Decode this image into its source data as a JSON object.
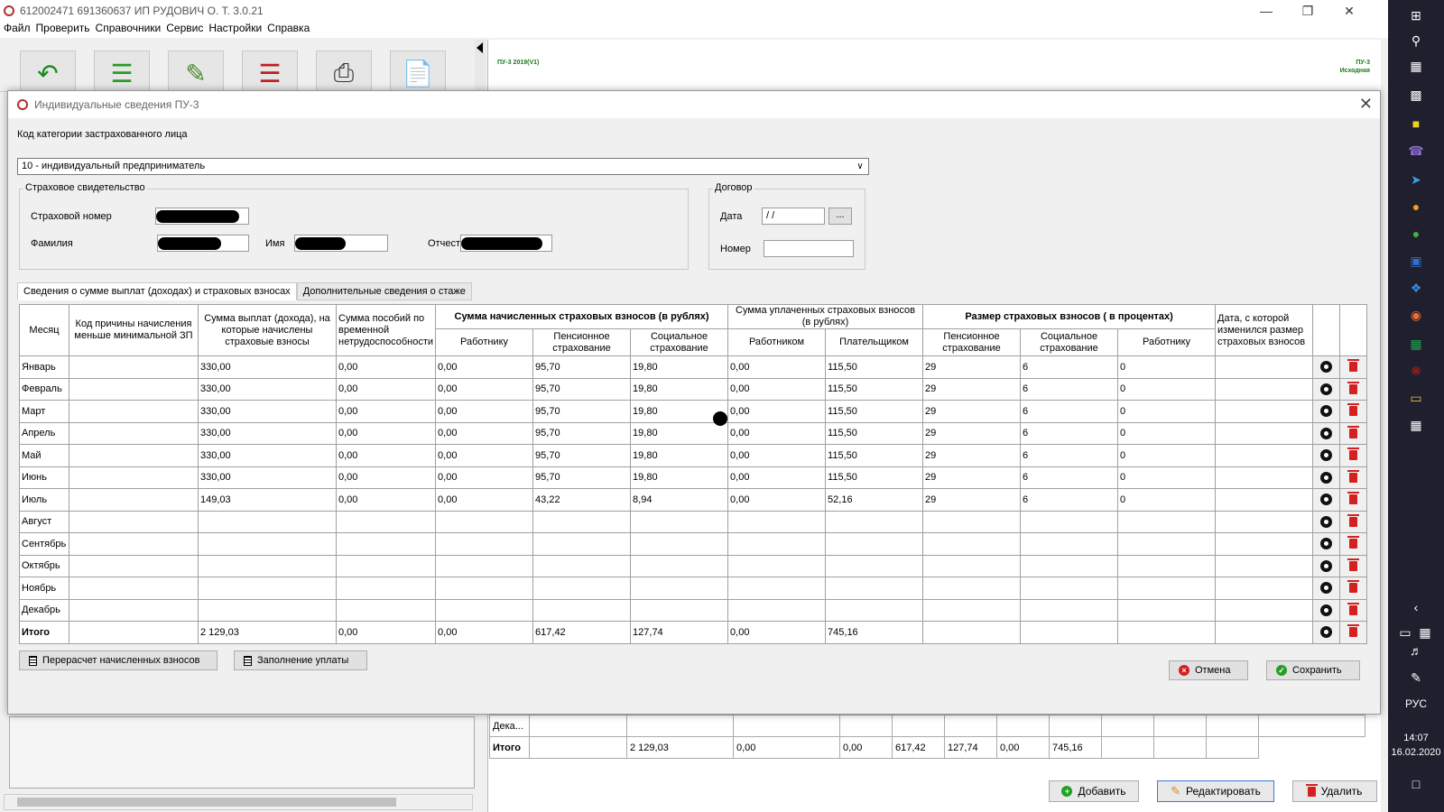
{
  "app": {
    "title": "612002471 691360637 ИП РУДОВИЧ О. Т. 3.0.21",
    "menu": [
      "Файл",
      "Проверить",
      "Справочники",
      "Сервис",
      "Настройки",
      "Справка"
    ],
    "rightpane": {
      "top_left_label": "ПУ-3 2019(V1)",
      "top_right_label_1": "ПУ-3",
      "top_right_label_2": "Исходная"
    }
  },
  "dialog": {
    "title": "Индивидуальные сведения ПУ-3",
    "category_label": "Код категории застрахованного лица",
    "category_value": "10 - индивидуальный предприниматель",
    "insurance_group": {
      "title": "Страховое свидетельство",
      "number_label": "Страховой номер",
      "surname_label": "Фамилия",
      "name_label": "Имя",
      "patronymic_label": "Отчество"
    },
    "contract_group": {
      "title": "Договор",
      "date_label": "Дата",
      "date_value": " / /",
      "date_button": "...",
      "number_label": "Номер"
    },
    "tabs": [
      "Сведения о сумме выплат (доходах) и страховых взносах",
      "Дополнительные сведения о стаже"
    ],
    "table": {
      "headers": {
        "month": "Месяц",
        "reason_code": "Код причины начисления меньше минимальной ЗП",
        "payments": "Сумма выплат (дохода), на которые начислены страховые взносы",
        "benefits": "Сумма пособий по временной нетрудоспособности",
        "accrued_group": "Сумма начисленных страховых взносов (в рублях)",
        "accrued_worker": "Работнику",
        "accrued_pension": "Пенсионное страхование",
        "accrued_social": "Социальное страхование",
        "paid_group": "Сумма уплаченных страховых взносов (в рублях)",
        "paid_worker": "Работником",
        "paid_payer": "Плательщиком",
        "rate_group": "Размер страховых взносов ( в процентах)",
        "rate_pension": "Пенсионное страхование",
        "rate_social": "Социальное страхование",
        "rate_worker": "Работнику",
        "rate_date": "Дата, с которой изменился размер страховых взносов"
      },
      "rows": [
        [
          "Январь",
          "",
          "330,00",
          "0,00",
          "0,00",
          "95,70",
          "19,80",
          "0,00",
          "115,50",
          "29",
          "6",
          "0",
          ""
        ],
        [
          "Февраль",
          "",
          "330,00",
          "0,00",
          "0,00",
          "95,70",
          "19,80",
          "0,00",
          "115,50",
          "29",
          "6",
          "0",
          ""
        ],
        [
          "Март",
          "",
          "330,00",
          "0,00",
          "0,00",
          "95,70",
          "19,80",
          "0,00",
          "115,50",
          "29",
          "6",
          "0",
          ""
        ],
        [
          "Апрель",
          "",
          "330,00",
          "0,00",
          "0,00",
          "95,70",
          "19,80",
          "0,00",
          "115,50",
          "29",
          "6",
          "0",
          ""
        ],
        [
          "Май",
          "",
          "330,00",
          "0,00",
          "0,00",
          "95,70",
          "19,80",
          "0,00",
          "115,50",
          "29",
          "6",
          "0",
          ""
        ],
        [
          "Июнь",
          "",
          "330,00",
          "0,00",
          "0,00",
          "95,70",
          "19,80",
          "0,00",
          "115,50",
          "29",
          "6",
          "0",
          ""
        ],
        [
          "Июль",
          "",
          "149,03",
          "0,00",
          "0,00",
          "43,22",
          "8,94",
          "0,00",
          "52,16",
          "29",
          "6",
          "0",
          ""
        ],
        [
          "Август",
          "",
          "",
          "",
          "",
          "",
          "",
          "",
          "",
          "",
          "",
          "",
          ""
        ],
        [
          "Сентябрь",
          "",
          "",
          "",
          "",
          "",
          "",
          "",
          "",
          "",
          "",
          "",
          ""
        ],
        [
          "Октябрь",
          "",
          "",
          "",
          "",
          "",
          "",
          "",
          "",
          "",
          "",
          "",
          ""
        ],
        [
          "Ноябрь",
          "",
          "",
          "",
          "",
          "",
          "",
          "",
          "",
          "",
          "",
          "",
          ""
        ],
        [
          "Декабрь",
          "",
          "",
          "",
          "",
          "",
          "",
          "",
          "",
          "",
          "",
          "",
          ""
        ]
      ],
      "total": [
        "Итого",
        "",
        "2 129,03",
        "0,00",
        "0,00",
        "617,42",
        "127,74",
        "0,00",
        "745,16",
        "",
        "",
        "",
        ""
      ]
    },
    "buttons": {
      "recalc": "Перерасчет начисленных взносов",
      "fill": "Заполнение уплаты",
      "cancel": "Отмена",
      "save": "Сохранить"
    }
  },
  "background": {
    "partial_row_label": "Дека...",
    "total_row": [
      "Итого",
      "",
      "2 129,03",
      "0,00",
      "0,00",
      "617,42",
      "127,74",
      "0,00",
      "745,16",
      "",
      "",
      ""
    ],
    "buttons": {
      "add": "Добавить",
      "edit": "Редактировать",
      "delete": "Удалить"
    }
  },
  "taskbar": {
    "language": "РУС",
    "time": "14:07",
    "date": "16.02.2020"
  },
  "colors": {
    "delete_red": "#d42020",
    "save_green": "#22a022",
    "cancel_red": "#d42020",
    "taskbar_bg": "#1f1f2e"
  }
}
